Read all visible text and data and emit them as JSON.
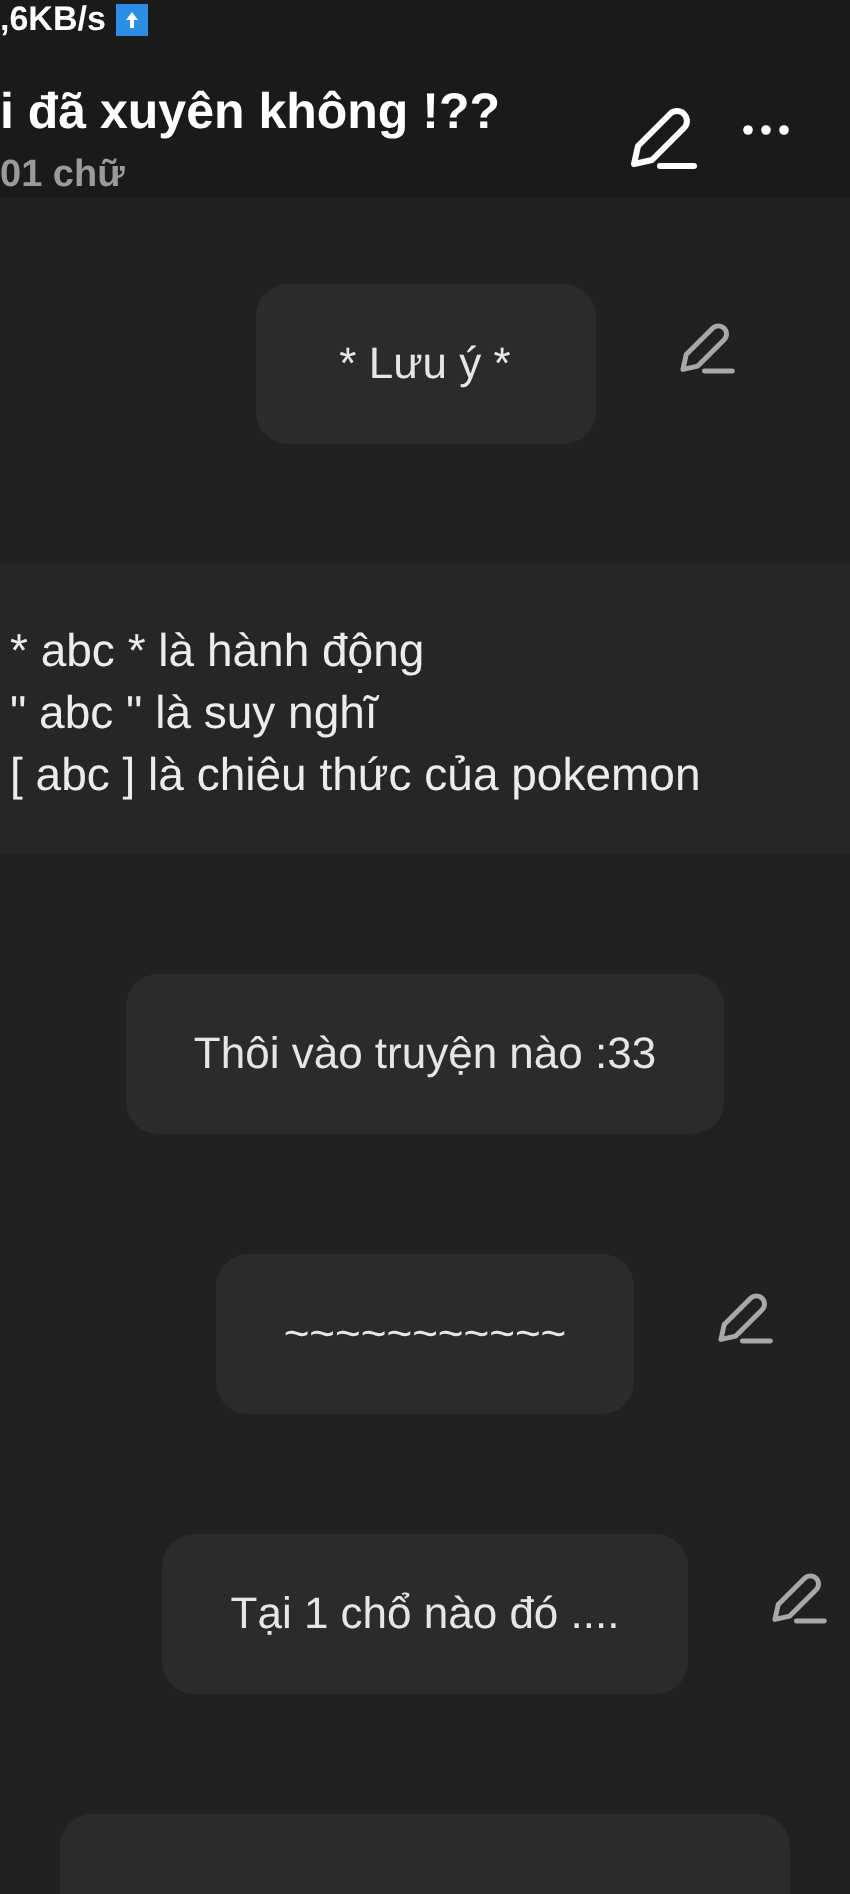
{
  "status_bar": {
    "speed": ",6KB/s"
  },
  "header": {
    "title": "i đã xuyên không !??",
    "word_count": "01 chữ"
  },
  "blocks": [
    {
      "kind": "bubble",
      "text": "* Lưu ý *",
      "editable": true
    },
    {
      "kind": "paragraph",
      "lines": [
        "* abc * là hành động",
        "\" abc \" là suy nghĩ",
        "[ abc ] là chiêu thức của pokemon"
      ]
    },
    {
      "kind": "bubble",
      "text": "Thôi vào truyện nào :33",
      "editable": false
    },
    {
      "kind": "bubble",
      "text": "~~~~~~~~~~~",
      "editable": true
    },
    {
      "kind": "bubble",
      "text": "Tại 1 chổ nào đó ....",
      "editable": true
    },
    {
      "kind": "bubble"
    }
  ]
}
